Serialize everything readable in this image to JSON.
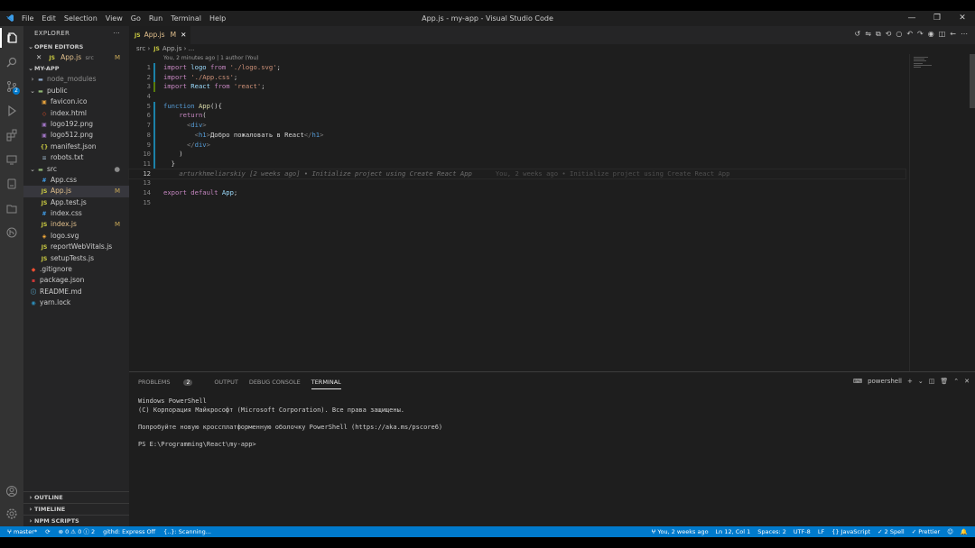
{
  "titlebar": {
    "menu": [
      "File",
      "Edit",
      "Selection",
      "View",
      "Go",
      "Run",
      "Terminal",
      "Help"
    ],
    "title": "App.js - my-app - Visual Studio Code"
  },
  "activity": {
    "scm_badge": "2"
  },
  "sidebar": {
    "header": "EXPLORER",
    "header_menu": "···",
    "open_editors_label": "OPEN EDITORS",
    "open_editor": {
      "close": "✕",
      "icon": "JS",
      "name": "App.js",
      "folder": "src",
      "status": "M"
    },
    "project_label": "MY-APP",
    "tree": [
      {
        "name": "node_modules",
        "type": "folder-closed",
        "depth": 1,
        "muted": true
      },
      {
        "name": "public",
        "type": "folder-open",
        "depth": 1
      },
      {
        "name": "favicon.ico",
        "type": "ico",
        "depth": 2
      },
      {
        "name": "index.html",
        "type": "html",
        "depth": 2
      },
      {
        "name": "logo192.png",
        "type": "png",
        "depth": 2
      },
      {
        "name": "logo512.png",
        "type": "png",
        "depth": 2
      },
      {
        "name": "manifest.json",
        "type": "json",
        "depth": 2
      },
      {
        "name": "robots.txt",
        "type": "txt",
        "depth": 2
      },
      {
        "name": "src",
        "type": "folder-open",
        "depth": 1,
        "dot": true
      },
      {
        "name": "App.css",
        "type": "css",
        "depth": 2
      },
      {
        "name": "App.js",
        "type": "js",
        "depth": 2,
        "status": "M",
        "selected": true
      },
      {
        "name": "App.test.js",
        "type": "js",
        "depth": 2
      },
      {
        "name": "index.css",
        "type": "css",
        "depth": 2
      },
      {
        "name": "index.js",
        "type": "js",
        "depth": 2,
        "status": "M"
      },
      {
        "name": "logo.svg",
        "type": "svg",
        "depth": 2
      },
      {
        "name": "reportWebVitals.js",
        "type": "js",
        "depth": 2
      },
      {
        "name": "setupTests.js",
        "type": "js",
        "depth": 2
      },
      {
        "name": ".gitignore",
        "type": "git",
        "depth": 1
      },
      {
        "name": "package.json",
        "type": "npm",
        "depth": 1
      },
      {
        "name": "README.md",
        "type": "md",
        "depth": 1
      },
      {
        "name": "yarn.lock",
        "type": "yarn",
        "depth": 1
      }
    ],
    "outline_label": "OUTLINE",
    "timeline_label": "TIMELINE",
    "npm_label": "NPM SCRIPTS"
  },
  "tab": {
    "icon": "JS",
    "name": "App.js",
    "status": "M",
    "close": "✕"
  },
  "breadcrumb": {
    "folder": "src",
    "sep": "›",
    "icon": "JS",
    "file": "App.js",
    "tail": "..."
  },
  "codelens": "You, 2 minutes ago | 1 author (You)",
  "code": [
    {
      "n": "1",
      "html": "<span class='kw'>import</span> <span class='var'>logo</span> <span class='kw'>from</span> <span class='str'>'./logo.svg'</span>;"
    },
    {
      "n": "2",
      "html": "<span class='kw'>import</span> <span class='str'>'./App.css'</span>;"
    },
    {
      "n": "3",
      "html": "<span class='kw'>import</span> <span class='var'>React</span> <span class='kw'>from</span> <span class='str'>'react'</span>;"
    },
    {
      "n": "4",
      "html": ""
    },
    {
      "n": "5",
      "html": "<span class='kb'>function</span> <span class='fn'>App</span>(){"
    },
    {
      "n": "6",
      "html": "    <span class='kw'>return</span>("
    },
    {
      "n": "7",
      "html": "      <span class='punc'>&lt;</span><span class='tag'>div</span><span class='punc'>&gt;</span>"
    },
    {
      "n": "8",
      "html": "        <span class='punc'>&lt;</span><span class='tag'>h1</span><span class='punc'>&gt;</span>Добро пожаловать в React<span class='punc'>&lt;/</span><span class='tag'>h1</span><span class='punc'>&gt;</span>"
    },
    {
      "n": "9",
      "html": "      <span class='punc'>&lt;/</span><span class='tag'>div</span><span class='punc'>&gt;</span>"
    },
    {
      "n": "10",
      "html": "    )"
    },
    {
      "n": "11",
      "html": "  }"
    },
    {
      "n": "12",
      "html": "    <span class='blame'>arturkhmeliarskiy [2 weeks ago] • Initialize project using Create React App</span>      <span class='blame2'>You, 2 weeks ago • Initialize project using Create React App</span>",
      "current": true
    },
    {
      "n": "13",
      "html": ""
    },
    {
      "n": "14",
      "html": "<span class='kw'>export</span> <span class='kw'>default</span> <span class='var'>App</span>;"
    },
    {
      "n": "15",
      "html": ""
    }
  ],
  "panel": {
    "tabs": [
      "PROBLEMS",
      "OUTPUT",
      "DEBUG CONSOLE",
      "TERMINAL"
    ],
    "problems_count": "2",
    "shell": "powershell",
    "terminal": [
      "Windows PowerShell",
      "(C) Корпорация Майкрософт (Microsoft Corporation). Все права защищены.",
      "",
      "Попробуйте новую кроссплатформенную оболочку PowerShell (https://aka.ms/pscore6)",
      "",
      "PS E:\\Programming\\React\\my-app>"
    ]
  },
  "statusbar": {
    "branch": "ⵖ master*",
    "sync": "⟳",
    "problems": "⊗ 0 ⚠ 0 ⓘ 2",
    "githd": "githd: Express Off",
    "scanning": "{..}: Scanning...",
    "blame": "ⵖ You, 2 weeks ago",
    "position": "Ln 12, Col 1",
    "spaces": "Spaces: 2",
    "encoding": "UTF-8",
    "eol": "LF",
    "language": "{} JavaScript",
    "spell": "✓ 2 Spell",
    "prettier": "✓ Prettier",
    "feedback": "☺",
    "bell": "🔔"
  },
  "colors": {
    "accent": "#007acc",
    "modified": "#e2c08d",
    "js_icon": "#cbcb41"
  }
}
